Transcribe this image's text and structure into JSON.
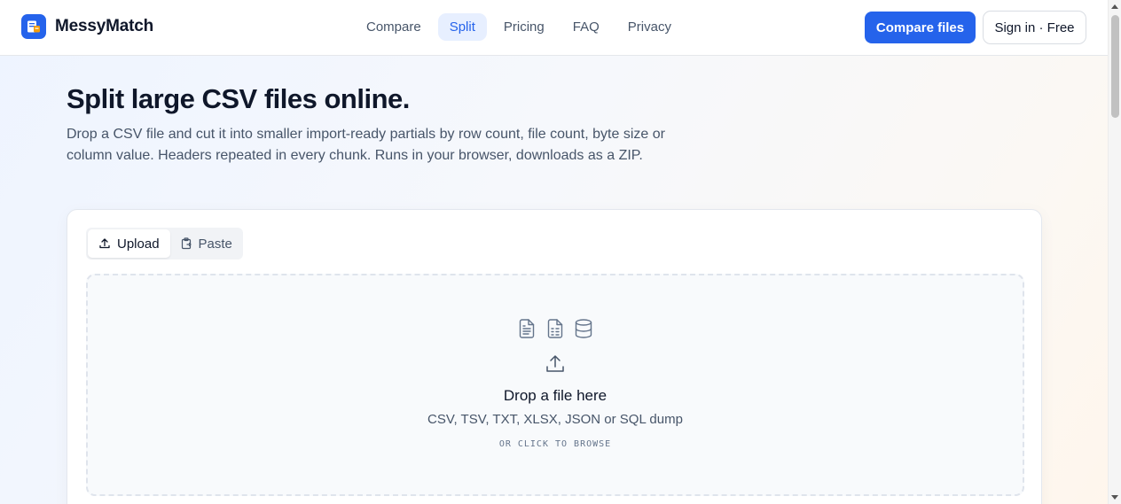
{
  "header": {
    "brand": "MessyMatch",
    "nav": [
      {
        "label": "Compare"
      },
      {
        "label": "Split"
      },
      {
        "label": "Pricing"
      },
      {
        "label": "FAQ"
      },
      {
        "label": "Privacy"
      }
    ],
    "active_nav": "Split",
    "primary_button": "Compare files",
    "secondary_button": "Sign in · Free"
  },
  "hero": {
    "title": "Split large CSV files online.",
    "description": "Drop a CSV file and cut it into smaller import-ready partials by row count, file count, byte size or column value. Headers repeated in every chunk. Runs in your browser, downloads as a ZIP."
  },
  "card": {
    "tabs": [
      {
        "label": "Upload",
        "icon": "upload-icon"
      },
      {
        "label": "Paste",
        "icon": "clipboard-icon"
      }
    ],
    "active_tab": "Upload",
    "dropzone": {
      "icons": [
        "file-text-icon",
        "file-spreadsheet-icon",
        "database-icon"
      ],
      "title": "Drop a file here",
      "formats": "CSV, TSV, TXT, XLSX, JSON or SQL dump",
      "hint": "OR CLICK TO BROWSE"
    }
  },
  "colors": {
    "accent": "#2563eb",
    "text": "#0f172a",
    "muted": "#475569"
  }
}
